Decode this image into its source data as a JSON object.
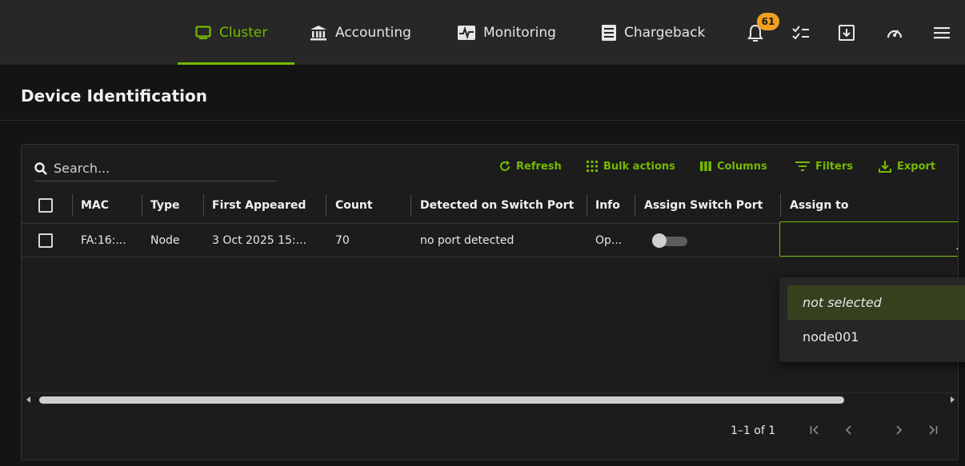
{
  "nav": {
    "tabs": [
      {
        "label": "Cluster",
        "icon": "monitor-icon",
        "active": true
      },
      {
        "label": "Accounting",
        "icon": "bank-icon",
        "active": false
      },
      {
        "label": "Monitoring",
        "icon": "activity-icon",
        "active": false
      },
      {
        "label": "Chargeback",
        "icon": "receipt-icon",
        "active": false
      }
    ],
    "notification_count": "61",
    "accent_color": "#76b900",
    "badge_color": "#f0a020"
  },
  "page": {
    "title": "Device Identification"
  },
  "toolbar": {
    "search_placeholder": "Search...",
    "refresh": "Refresh",
    "bulk_actions": "Bulk actions",
    "columns": "Columns",
    "filters": "Filters",
    "export": "Export"
  },
  "table": {
    "columns": [
      "MAC",
      "Type",
      "First Appeared",
      "Count",
      "Detected on Switch Port",
      "Info",
      "Assign Switch Port",
      "Assign to"
    ],
    "rows": [
      {
        "mac": "FA:16:...",
        "type": "Node",
        "first_appeared": "3 Oct 2025 15:...",
        "count": "70",
        "detected_port": "no port detected",
        "info": "Op...",
        "assign_switch_port": false,
        "assign_to": ""
      }
    ]
  },
  "dropdown": {
    "options": [
      "not selected",
      "node001"
    ],
    "selected": "not selected"
  },
  "pagination": {
    "text": "1–1 of 1"
  }
}
